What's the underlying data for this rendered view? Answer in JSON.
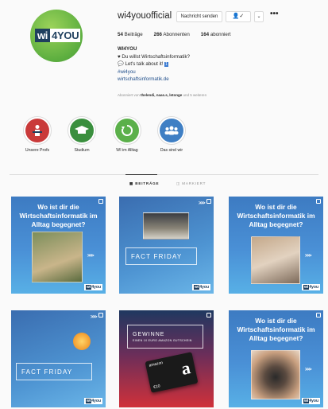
{
  "profile": {
    "username": "wi4youofficial",
    "logo_left": "wi",
    "logo_right": "4YOU",
    "btn_message": "Nachricht senden",
    "btn_follow": "👤✓",
    "btn_dropdown": "⌄",
    "more": "•••",
    "stats": {
      "posts_count": "54",
      "posts_label": "Beiträge",
      "followers_count": "266",
      "followers_label": "Abonnenten",
      "following_count": "164",
      "following_label": "abonniert"
    },
    "bio": {
      "name": "WI4YOU",
      "line1": "Du willst Wirtschaftsinformatik?",
      "line2": "Let's talk about it!",
      "badge": "1",
      "hashtag": "#wi4you",
      "link": "wirtschaftsinformatik.de"
    },
    "followed_by_prefix": "Abonniert von ",
    "followed_by_names": "thelendi, naas.s, letonge",
    "followed_by_suffix": " und 5 weiteren"
  },
  "highlights": [
    {
      "label": "Unsere Profs",
      "icon": "professor-icon",
      "color": "#c93a3a"
    },
    {
      "label": "Studium",
      "icon": "graduation-cap-icon",
      "color": "#3a8f3e"
    },
    {
      "label": "WI im Alltag",
      "icon": "refresh-icon",
      "color": "#5bb04a"
    },
    {
      "label": "Das sind wir",
      "icon": "group-icon",
      "color": "#3f7fc4"
    }
  ],
  "tabs": {
    "posts": "BEITRÄGE",
    "tagged": "MARKIERT"
  },
  "posts": [
    {
      "title": "Wo ist dir die Wirtschaftsinformatik im Alltag begegnet?",
      "arrows": ">>>"
    },
    {
      "title": "FACT FRIDAY",
      "arrows": ">>>"
    },
    {
      "title": "Wo ist dir die Wirtschaftsinformatik im Alltag begegnet?",
      "arrows": ">>>"
    },
    {
      "title": "FACT FRIDAY",
      "arrows": ">>>"
    },
    {
      "title": "GEWINNE",
      "subtitle": "EINEN 10 EURO AMAZON GUTSCHEIN",
      "amount": "€10",
      "brand": "amazon"
    },
    {
      "title": "Wo ist dir die Wirtschaftsinformatik im Alltag begegnet?",
      "arrows": ">>>"
    }
  ],
  "post_logo_left": "wi",
  "post_logo_right": "4you",
  "colors": {
    "accent_blue": "#3d7bc2",
    "brand_navy": "#1f3f5e",
    "brand_green": "#5cae3f"
  }
}
